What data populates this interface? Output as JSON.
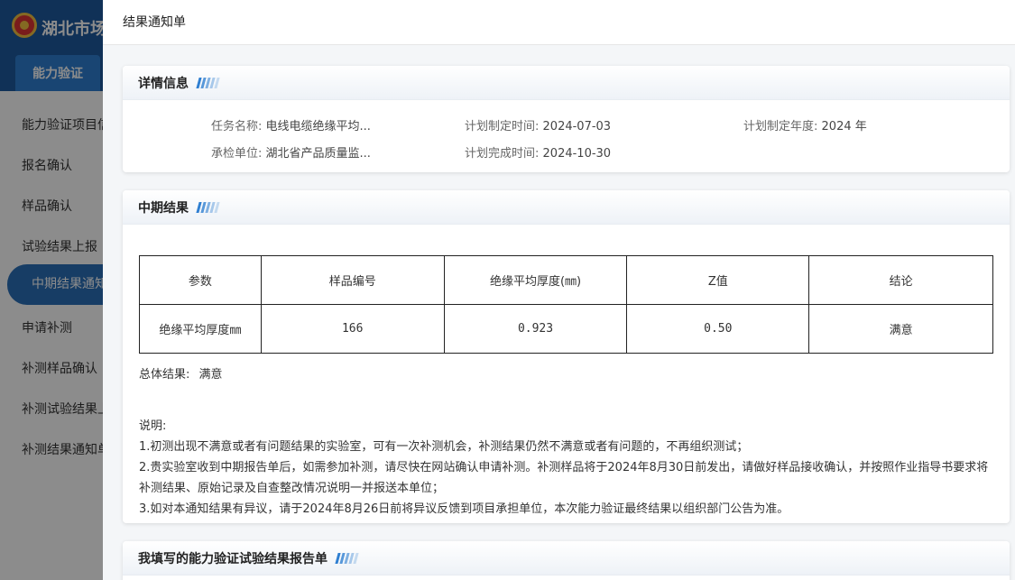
{
  "background": {
    "app_title": "湖北市场监",
    "top_tab": "能力验证",
    "menu": [
      "能力验证项目信",
      "报名确认",
      "样品确认",
      "试验结果上报",
      "中期结果通知",
      "申请补测",
      "补测样品确认",
      "补测试验结果上",
      "补测结果通知单"
    ]
  },
  "drawer": {
    "title": "结果通知单",
    "details": {
      "heading": "详情信息",
      "task_name_label": "任务名称:",
      "task_name_value": "电线电缆绝缘平均...",
      "unit_label": "承检单位:",
      "unit_value": "湖北省产品质量监...",
      "plan_time_label": "计划制定时间:",
      "plan_time_value": "2024-07-03",
      "finish_time_label": "计划完成时间:",
      "finish_time_value": "2024-10-30",
      "plan_year_label": "计划制定年度:",
      "plan_year_value": "2024 年"
    },
    "interim": {
      "heading": "中期结果",
      "table_headers": [
        "参数",
        "样品编号",
        "绝缘平均厚度(㎜)",
        "Z值",
        "结论"
      ],
      "rows": [
        [
          "绝缘平均厚度㎜",
          "166",
          "0.923",
          "0.50",
          "满意"
        ]
      ],
      "overall_label": "总体结果:",
      "overall_value": "满意",
      "notes_title": "说明:",
      "notes": [
        "1.初测出现不满意或者有问题结果的实验室，可有一次补测机会，补测结果仍然不满意或者有问题的，不再组织测试；",
        "2.贵实验室收到中期报告单后，如需参加补测，请尽快在网站确认申请补测。补测样品将于2024年8月30日前发出，请做好样品接收确认，并按照作业指导书要求将补测结果、原始记录及自查整改情况说明一并报送本单位；",
        "3.如对本通知结果有异议，请于2024年8月26日前将异议反馈到项目承担单位，本次能力验证最终结果以组织部门公告为准。"
      ]
    },
    "report": {
      "heading": "我填写的能力验证试验结果报告单"
    }
  }
}
